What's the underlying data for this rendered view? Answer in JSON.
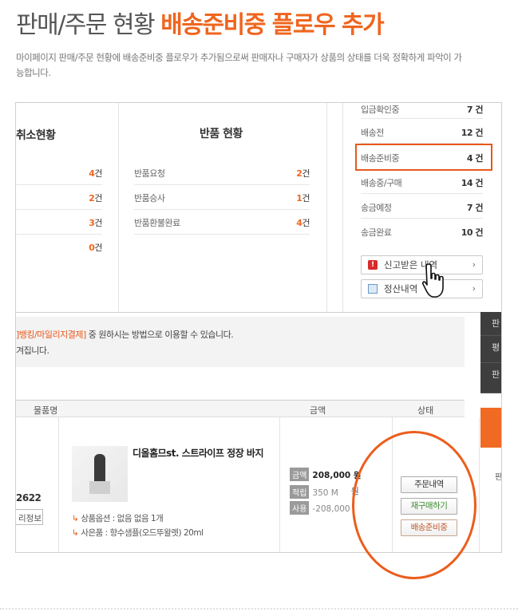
{
  "header": {
    "title_gray": "판매/주문 현황",
    "title_orange": "배송준비중 플로우 추가",
    "desc": "마이페이지 판매/주문 현황에 배송준비중 플로우가 추가됨으로써 판매자나 구매자가 상품의 상태를 더욱 정확하게 파악이 가능합니다."
  },
  "cancel": {
    "title": "취소현황",
    "counts": [
      "4",
      "2",
      "3",
      "0"
    ],
    "unit": "건"
  },
  "returns": {
    "title": "반품 현황",
    "items": [
      {
        "label": "반품요청",
        "count": "2"
      },
      {
        "label": "반품승사",
        "count": "1"
      },
      {
        "label": "반품환불완료",
        "count": "4"
      }
    ],
    "unit": "건"
  },
  "status": {
    "items": [
      {
        "label": "입금확인중",
        "count": "7 건"
      },
      {
        "label": "배송전",
        "count": "12 건"
      },
      {
        "label": "배송준비중",
        "count": "4 건"
      },
      {
        "label": "배송중/구매",
        "count": "14 건"
      },
      {
        "label": "송금예정",
        "count": "7 건"
      },
      {
        "label": "송금완료",
        "count": "10 건"
      }
    ]
  },
  "side_buttons": {
    "report": "신고받은 내역",
    "settle": "정산내역",
    "arrow": "›"
  },
  "info": {
    "line1_orange": "]뱅킹/마일리지결제]",
    "line1_rest": " 중 원하시는 방법으로 이용할 수 있습니다.",
    "line2": "겨집니다."
  },
  "right_tabs": [
    "판",
    "평",
    "판"
  ],
  "table": {
    "headers": {
      "product": "물품명",
      "amount": "금액",
      "status": "상태"
    }
  },
  "order": {
    "number": "2622",
    "info_btn": "리정보",
    "product_name": "디올홈므st. 스트라이프 정장 바지",
    "option_line": "상품옵션 : 없음 없음 1개",
    "gift_line": "사은품 : 향수샘플(오드뚜왈렛) 20ml",
    "price_label": "금액",
    "price": "208,000 원",
    "point_label": "적립",
    "point": "350 M",
    "use_label": "사용",
    "use": "-208,000",
    "extra": "원"
  },
  "actions": {
    "order_detail": "주문내역",
    "rebuy": "재구매하기",
    "preparing": "배송준비중"
  },
  "colors": {
    "accent": "#f0651e",
    "highlight": "#e8581c",
    "green": "#3a8a2e",
    "text": "#444444"
  }
}
